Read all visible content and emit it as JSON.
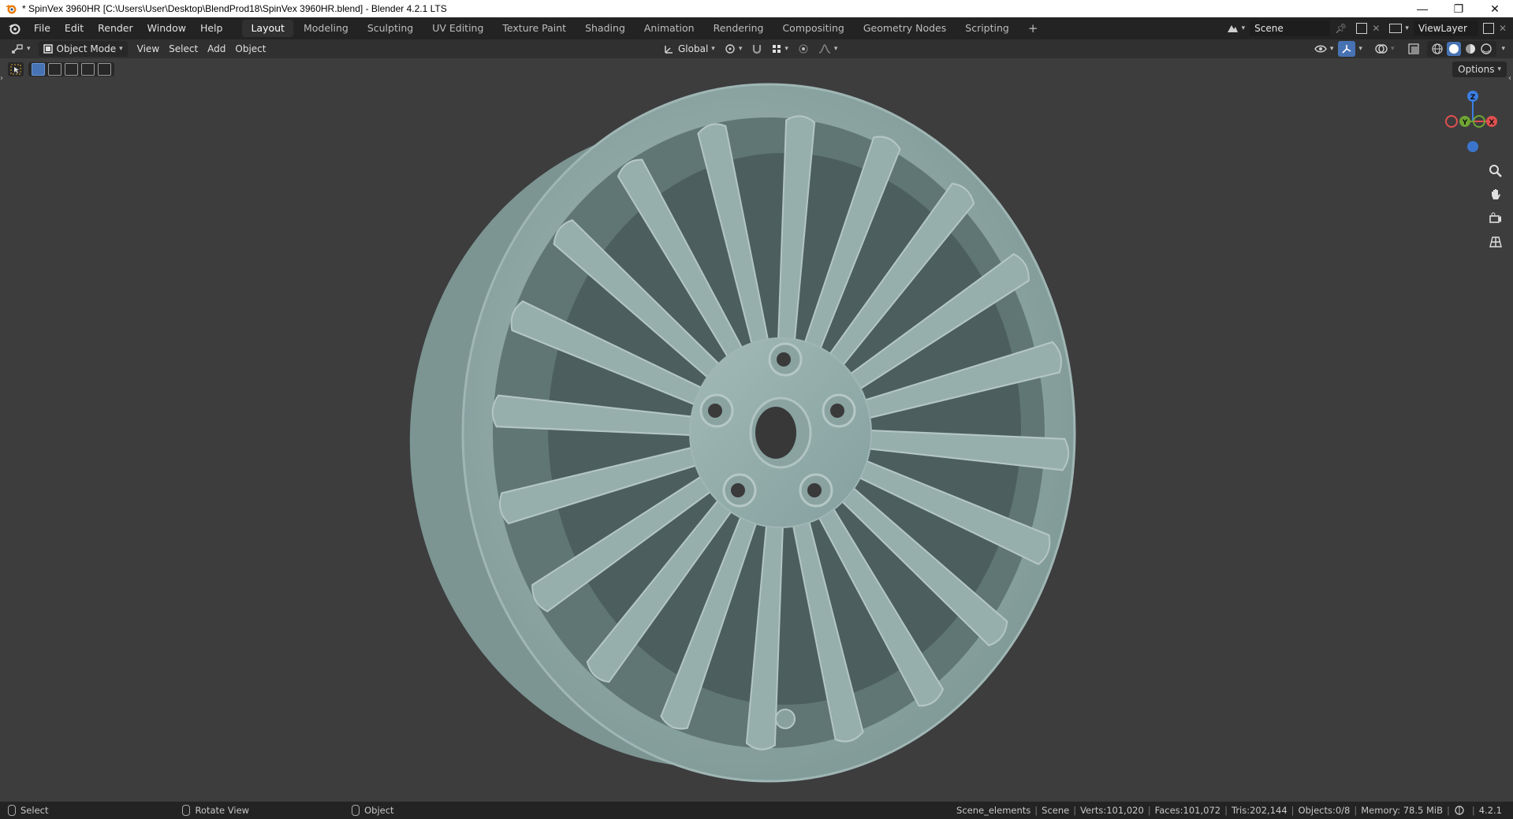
{
  "window": {
    "title": "* SpinVex 3960HR [C:\\Users\\User\\Desktop\\BlendProd18\\SpinVex 3960HR.blend] - Blender 4.2.1 LTS",
    "controls": [
      "—",
      "❐",
      "✕"
    ]
  },
  "menu": {
    "items": [
      "File",
      "Edit",
      "Render",
      "Window",
      "Help"
    ]
  },
  "workspaces": {
    "tabs": [
      "Layout",
      "Modeling",
      "Sculpting",
      "UV Editing",
      "Texture Paint",
      "Shading",
      "Animation",
      "Rendering",
      "Compositing",
      "Geometry Nodes",
      "Scripting"
    ],
    "active": "Layout",
    "add": "+"
  },
  "scene": {
    "name": "Scene",
    "view_layer": "ViewLayer"
  },
  "viewport_header": {
    "mode": "Object Mode",
    "menus": [
      "View",
      "Select",
      "Add",
      "Object"
    ],
    "transform_orientation": "Global",
    "options": "Options"
  },
  "gizmo": {
    "z": "Z",
    "y": "Y",
    "x": "X"
  },
  "statusbar": {
    "left": [
      {
        "label": "Select"
      },
      {
        "label": "Rotate View"
      },
      {
        "label": "Object"
      }
    ],
    "stats": {
      "collection": "Scene_elements",
      "scene": "Scene",
      "verts": "Verts:101,020",
      "faces": "Faces:101,072",
      "tris": "Tris:202,144",
      "objects": "Objects:0/8",
      "memory": "Memory: 78.5 MiB",
      "version": "4.2.1"
    }
  },
  "colors": {
    "viewport_bg": "#3d3d3d",
    "wheel": "#8fa8a6",
    "accent": "#4772b3",
    "axis_x": "#e0504f",
    "axis_y": "#6fa534",
    "axis_z": "#3b7fe4"
  }
}
